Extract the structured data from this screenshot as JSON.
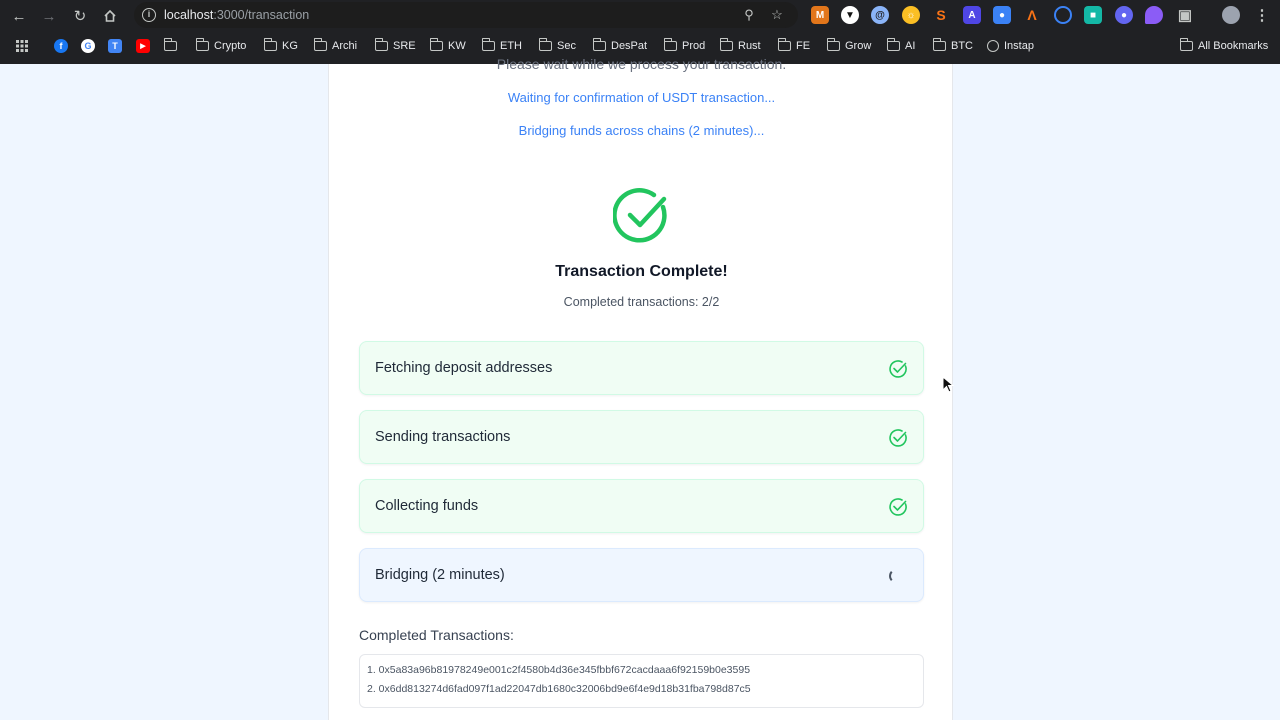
{
  "browser": {
    "url_host": "localhost",
    "url_path": ":3000/transaction",
    "bookmarks": [
      {
        "label": "Crypto"
      },
      {
        "label": "KG"
      },
      {
        "label": "Archi"
      },
      {
        "label": "SRE"
      },
      {
        "label": "KW"
      },
      {
        "label": "ETH"
      },
      {
        "label": "Sec"
      },
      {
        "label": "DesPat"
      },
      {
        "label": "Prod"
      },
      {
        "label": "Rust"
      },
      {
        "label": "FE"
      },
      {
        "label": "Grow"
      },
      {
        "label": "AI"
      },
      {
        "label": "BTC"
      },
      {
        "label": "Instap"
      }
    ],
    "all_bookmarks": "All Bookmarks"
  },
  "page": {
    "wait_message": "Please wait while we process your transaction.",
    "status_lines": [
      "Waiting for confirmation of USDT transaction...",
      "Bridging funds across chains (2 minutes)..."
    ],
    "complete_title": "Transaction Complete!",
    "complete_count": "Completed transactions: 2/2",
    "steps": [
      {
        "label": "Fetching deposit addresses",
        "status": "done"
      },
      {
        "label": "Sending transactions",
        "status": "done"
      },
      {
        "label": "Collecting funds",
        "status": "done"
      },
      {
        "label": "Bridging (2 minutes)",
        "status": "in-progress"
      }
    ],
    "completed_heading": "Completed Transactions:",
    "transactions": [
      "1. 0x5a83a96b81978249e001c2f4580b4d36e345fbbf672cacdaaa6f92159b0e3595",
      "2. 0x6dd813274d6fad097f1ad22047db1680c32006bd9e6f4e9d18b31fba798d87c5"
    ]
  },
  "colors": {
    "success": "#22c55e",
    "info_text": "#3b82f6",
    "done_bg": "#f0fdf4",
    "active_bg": "#eff6ff"
  }
}
